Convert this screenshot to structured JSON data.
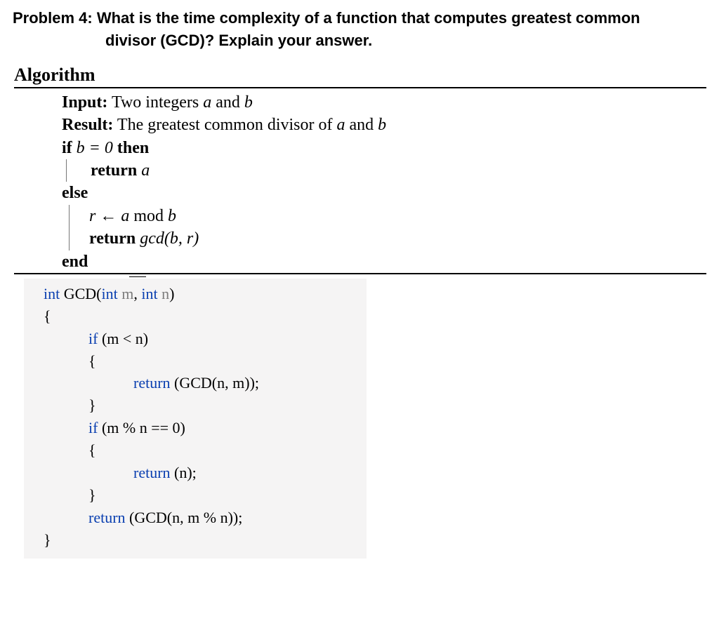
{
  "problem": {
    "label": "Problem 4:  ",
    "question_line1": "What is the time complexity of a function that computes greatest common",
    "question_line2": "divisor (GCD)? Explain your answer."
  },
  "algorithm": {
    "title": "Algorithm",
    "input_label": "Input:",
    "input_text_prefix": " Two integers ",
    "var_a": "a",
    "and_word": " and ",
    "var_b": "b",
    "result_label": "Result:",
    "result_text_prefix": " The greatest common divisor of ",
    "if_kw": "if ",
    "cond": "b = 0",
    "then_kw": " then",
    "return_kw": "return ",
    "return_a_var": "a",
    "else_kw": "else",
    "assign_r": "r",
    "assign_arrow": " ← ",
    "assign_expr": "a",
    "mod_word": " mod ",
    "assign_b": "b",
    "gcd_call_fn": "gcd",
    "gcd_call_args": "(b, r)",
    "end_kw": "end"
  },
  "code": {
    "l1_int": "int",
    "l1_fn": " GCD(",
    "l1_int2": "int",
    "l1_m": " m",
    "l1_comma": ", ",
    "l1_int3": "int",
    "l1_n": " n",
    "l1_close": ")",
    "l2": "{",
    "l3_if": "if",
    "l3_cond": " (m < n)",
    "l4": "{",
    "l5_return": "return",
    "l5_rest": " (GCD(n, m));",
    "l6": "}",
    "l7_if": "if",
    "l7_cond": " (m % n == 0)",
    "l8": "{",
    "l9_return": "return",
    "l9_rest": " (n);",
    "l10": "}",
    "l11_return": "return",
    "l11_rest": " (GCD(n, m % n));",
    "l12": "}"
  }
}
